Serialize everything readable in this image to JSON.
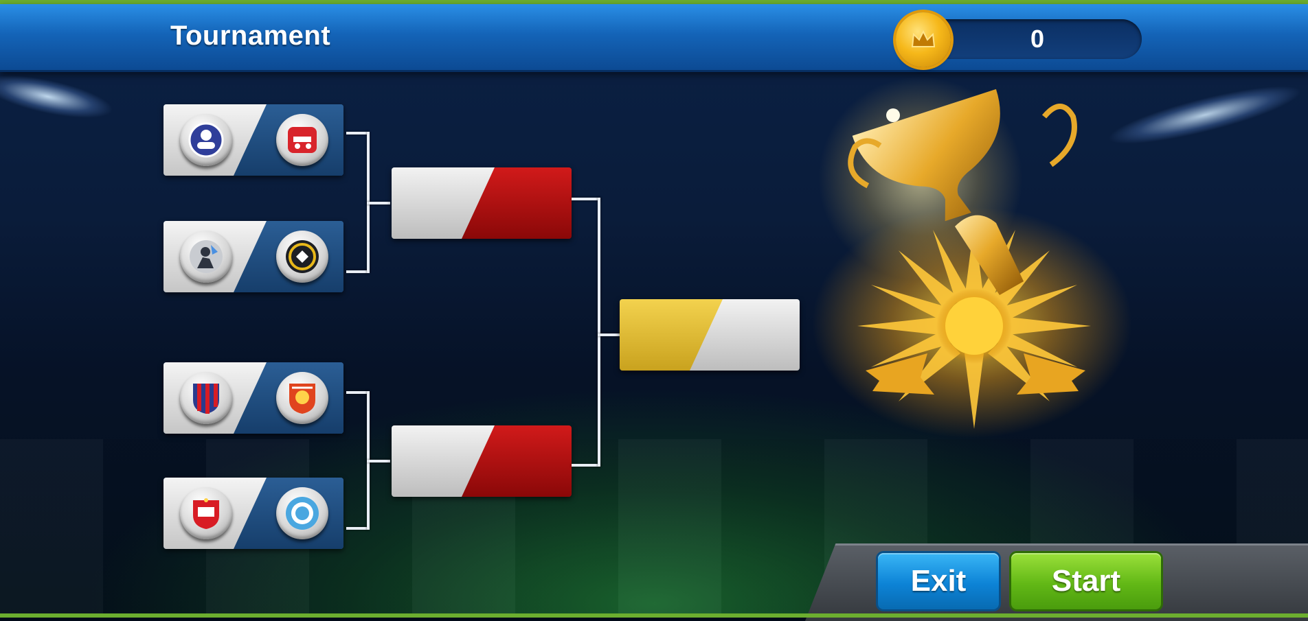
{
  "header": {
    "title": "Tournament",
    "coins": "0",
    "coin_icon": "crown-coin-icon"
  },
  "bracket": {
    "quarterfinals": [
      {
        "team_a": {
          "badge_icon": "esteghlal-club-badge-icon",
          "color": "#3d4fa8"
        },
        "team_b": {
          "badge_icon": "tractor-club-badge-icon",
          "color": "#d8242b"
        }
      },
      {
        "team_a": {
          "badge_icon": "silhouette-club-badge-icon",
          "color": "#5c6470"
        },
        "team_b": {
          "badge_icon": "yellow-ring-club-badge-icon",
          "color": "#e8b81a"
        }
      },
      {
        "team_a": {
          "badge_icon": "striped-club-badge-icon",
          "color": "#2a3b8e"
        },
        "team_b": {
          "badge_icon": "orange-red-club-badge-icon",
          "color": "#e0441e"
        }
      },
      {
        "team_a": {
          "badge_icon": "persepolis-club-badge-icon",
          "color": "#d81c24"
        },
        "team_b": {
          "badge_icon": "sky-blue-club-badge-icon",
          "color": "#4aa7e0"
        }
      }
    ],
    "semifinals": [
      {
        "left_color": "#d9d9d9",
        "right_color": "#b90f12"
      },
      {
        "left_color": "#d9d9d9",
        "right_color": "#b90f12"
      }
    ],
    "final": {
      "left_color": "#e2bd2f",
      "right_color": "#d9d9d9"
    }
  },
  "trophy": {
    "icon": "golden-trophy-icon"
  },
  "buttons": {
    "exit": "Exit",
    "start": "Start",
    "exit_color": "#1a96e3",
    "start_color": "#72c720"
  }
}
